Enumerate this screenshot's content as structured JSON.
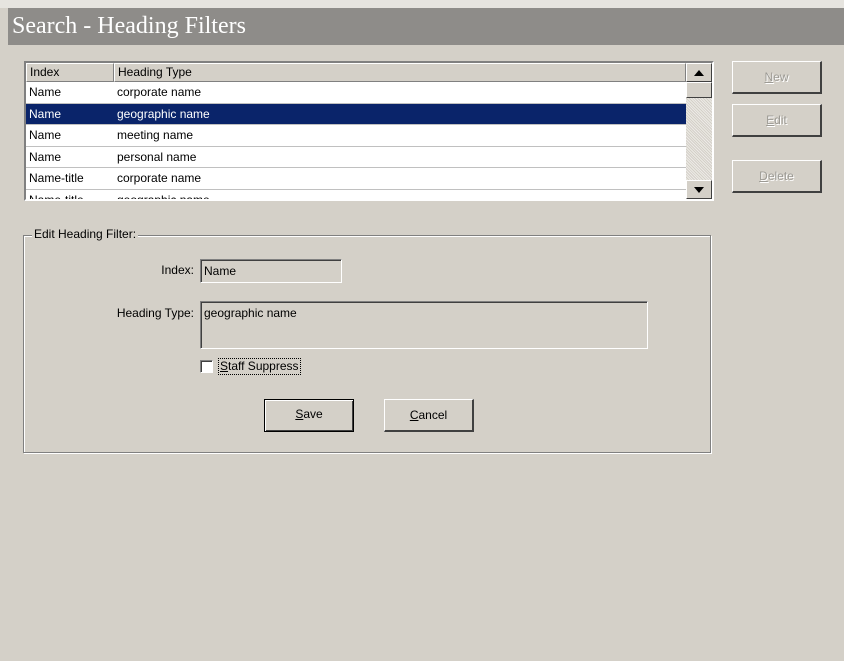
{
  "window": {
    "title": "Search - Heading Filters"
  },
  "list": {
    "columns": [
      "Index",
      "Heading Type"
    ],
    "rows": [
      {
        "index": "Name",
        "heading_type": "corporate name",
        "selected": false
      },
      {
        "index": "Name",
        "heading_type": "geographic name",
        "selected": true
      },
      {
        "index": "Name",
        "heading_type": "meeting name",
        "selected": false
      },
      {
        "index": "Name",
        "heading_type": "personal name",
        "selected": false
      },
      {
        "index": "Name-title",
        "heading_type": "corporate name",
        "selected": false
      },
      {
        "index": "Name-title",
        "heading_type": "geographic name",
        "selected": false
      }
    ]
  },
  "side_buttons": {
    "new": {
      "label_accel": "N",
      "label_rest": "ew",
      "enabled": false
    },
    "edit": {
      "label_accel": "E",
      "label_rest": "dit",
      "enabled": false
    },
    "delete": {
      "label_accel": "D",
      "label_rest": "elete",
      "enabled": false
    }
  },
  "edit_group": {
    "legend": "Edit Heading Filter:",
    "index_label": "Index:",
    "index_value": "Name",
    "heading_type_label": "Heading Type:",
    "heading_type_value": "geographic name",
    "staff_suppress": {
      "label_accel": "S",
      "label_rest": "taff Suppress",
      "checked": false
    },
    "save": {
      "label_accel": "S",
      "label_rest": "ave"
    },
    "cancel": {
      "label_accel": "C",
      "label_rest": "ancel"
    }
  },
  "colors": {
    "selection": "#0a246a",
    "face": "#d4d0c8",
    "title_bar": "#8e8c89"
  }
}
